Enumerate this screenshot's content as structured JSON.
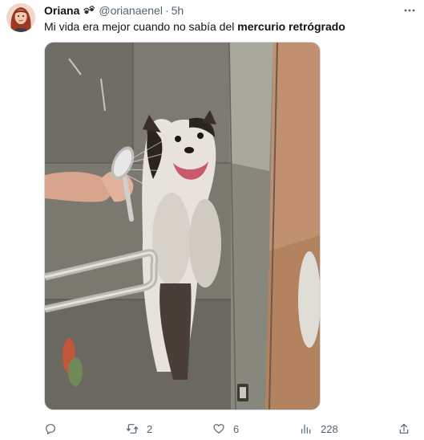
{
  "tweet": {
    "display_name": "Oriana",
    "name_emoji": "paw-prints-emoji",
    "handle": "@orianaenel",
    "separator": "·",
    "time": "5h",
    "text_prefix": "Mi vida era mejor cuando no sabía del ",
    "text_bold": "mercurio retrógrado"
  },
  "media": {
    "subject": "dog-in-shower-photo"
  },
  "actions": {
    "reply": {
      "icon": "reply-icon",
      "count": ""
    },
    "retweet": {
      "icon": "retweet-icon",
      "count": "2"
    },
    "like": {
      "icon": "heart-icon",
      "count": "6"
    },
    "views": {
      "icon": "views-icon",
      "count": "228"
    },
    "share": {
      "icon": "share-icon"
    }
  },
  "colors": {
    "text": "#0f1419",
    "secondary": "#536471",
    "border": "#cfd9de"
  }
}
